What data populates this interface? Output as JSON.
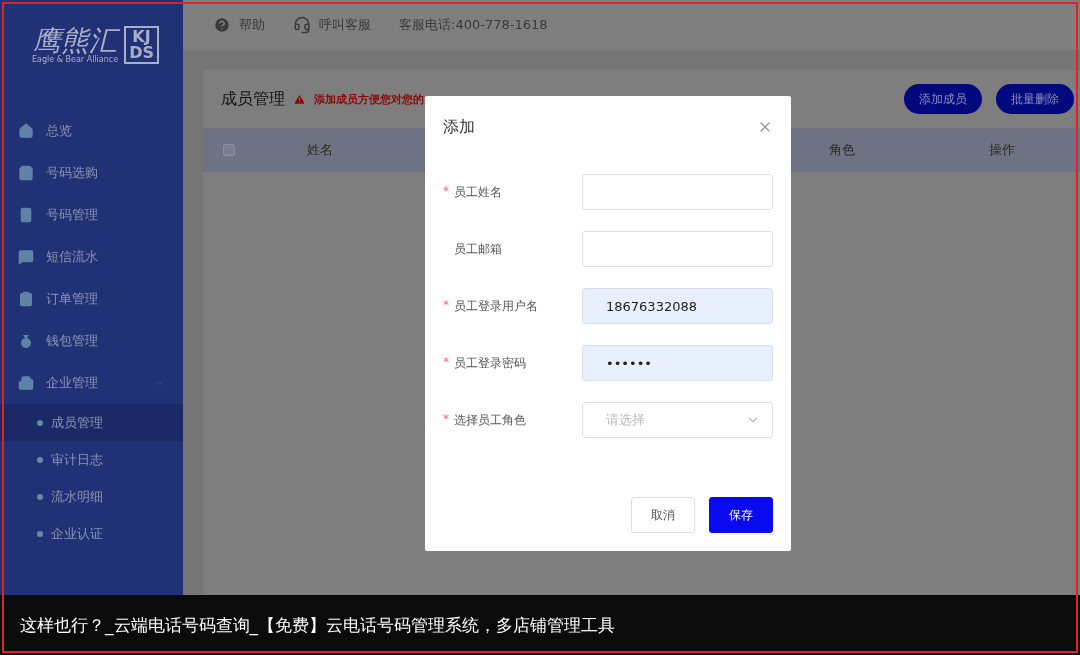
{
  "sidebar": {
    "logo": {
      "name": "鹰熊汇",
      "tagline": "Eagle & Bear Alliance",
      "mark_top": "KJ",
      "mark_bottom": "DS"
    },
    "items": [
      {
        "label": "总览"
      },
      {
        "label": "号码选购"
      },
      {
        "label": "号码管理"
      },
      {
        "label": "短信流水"
      },
      {
        "label": "订单管理"
      },
      {
        "label": "钱包管理"
      },
      {
        "label": "企业管理",
        "expanded": true,
        "children": [
          {
            "label": "成员管理",
            "selected": true
          },
          {
            "label": "审计日志",
            "selected": false
          },
          {
            "label": "流水明细",
            "selected": false
          },
          {
            "label": "企业认证",
            "selected": false
          }
        ]
      }
    ]
  },
  "header": {
    "help": "帮助",
    "service": "呼叫客服",
    "phone": "客服电话:400-778-1618"
  },
  "page": {
    "title": "成员管理",
    "notice": "添加成员方便您对您的",
    "buttons": [
      "添加成员",
      "批量删除"
    ],
    "table": {
      "checked": false,
      "columns": [
        "姓名",
        "角色",
        "操作"
      ]
    }
  },
  "dialog": {
    "title": "添加",
    "fields": [
      {
        "kind": "input",
        "label": "员工姓名",
        "marker": "*",
        "autofilled": false
      },
      {
        "kind": "input",
        "label": "员工邮箱",
        "autofilled": false
      },
      {
        "kind": "input",
        "label": "员工登录用户名",
        "marker": "*",
        "autofilled": true,
        "value": "18676332088"
      },
      {
        "kind": "input",
        "label": "员工登录密码",
        "marker": "*",
        "autofilled": true,
        "value": "••••••"
      },
      {
        "kind": "select",
        "label": "选择员工角色",
        "marker": "*",
        "autofilled": false,
        "placeholder": "请选择"
      }
    ],
    "cancel": "取消",
    "save": "保存"
  },
  "caption": "这样也行？_云端电话号码查询_【免费】云电话号码管理系统，多店铺管理工具"
}
